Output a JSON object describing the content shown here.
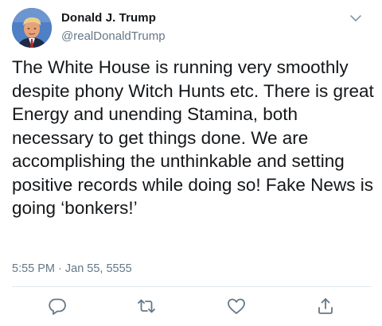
{
  "tweet": {
    "author_name": "Donald J. Trump",
    "author_handle": "@realDonaldTrump",
    "text": "The White House is running very smoothly despite phony Witch Hunts etc. There is great Energy and unending Stamina, both necessary to get things done. We are accomplishing the unthinkable and setting positive records while doing so! Fake News is going ‘bonkers!’",
    "timestamp": "5:55 PM · Jan 55, 5555"
  },
  "icons": {
    "more": "chevron-down-icon",
    "reply": "reply-icon",
    "retweet": "retweet-icon",
    "like": "heart-icon",
    "share": "share-icon"
  },
  "colors": {
    "text_primary": "#14171a",
    "text_secondary": "#657786",
    "icon": "#657786",
    "divider": "#e1e8ed"
  }
}
